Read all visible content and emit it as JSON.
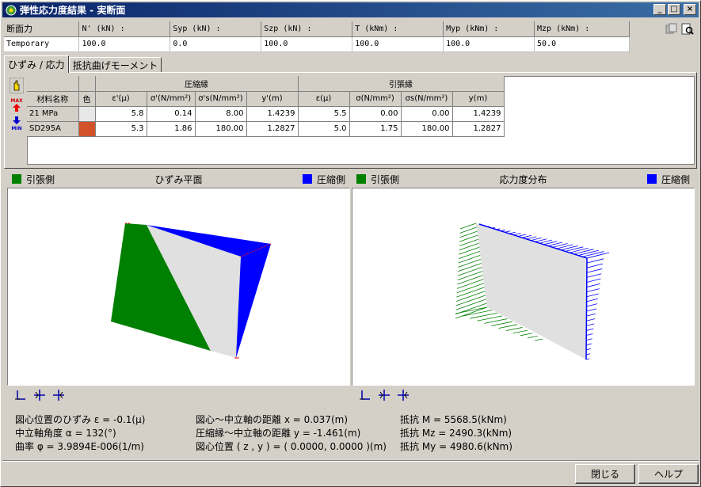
{
  "window": {
    "title": "弾性応力度結果 - 実断面"
  },
  "force": {
    "row_header": "断面力",
    "row_label": "Temporary",
    "columns": [
      {
        "label": "N' (kN) :",
        "value": "100.0"
      },
      {
        "label": "Syp (kN) :",
        "value": "0.0"
      },
      {
        "label": "Szp (kN) :",
        "value": "100.0"
      },
      {
        "label": "T (kNm) :",
        "value": "100.0"
      },
      {
        "label": "Myp (kNm) :",
        "value": "100.0"
      },
      {
        "label": "Mzp (kNm) :",
        "value": "50.0"
      }
    ]
  },
  "tabs": [
    {
      "label": "ひずみ / 応力"
    },
    {
      "label": "抵抗曲げモーメント"
    }
  ],
  "table": {
    "group_comp": "圧縮縁",
    "group_tens": "引張縁",
    "h_name": "材料名称",
    "h_color": "色",
    "headers": [
      "ε'(μ)",
      "σ'(N/mm²)",
      "σ's(N/mm²)",
      "y'(m)",
      "ε(μ)",
      "σ(N/mm²)",
      "σs(N/mm²)",
      "y(m)"
    ],
    "rows": [
      {
        "name": "21 MPa",
        "color": "#e8e8e8",
        "vals": [
          "5.8",
          "0.14",
          "8.00",
          "1.4239",
          "5.5",
          "0.00",
          "0.00",
          "1.4239"
        ]
      },
      {
        "name": "SD295A",
        "color": "#d2522a",
        "vals": [
          "5.3",
          "1.86",
          "180.00",
          "1.2827",
          "5.0",
          "1.75",
          "180.00",
          "1.2827"
        ]
      }
    ]
  },
  "side_icons": [
    "hand-icon",
    "max-icon",
    "min-icon"
  ],
  "left_chart": {
    "legend_left": "引張側",
    "title": "ひずみ平面",
    "legend_right": "圧縮側",
    "color_tension": "#008000",
    "color_compression": "#0000ff"
  },
  "right_chart": {
    "legend_left": "引張側",
    "title": "応力度分布",
    "legend_right": "圧縮側",
    "color_tension": "#008000",
    "color_compression": "#0000ff"
  },
  "info": {
    "col1": [
      "図心位置のひずみ ε = -0.1(μ)",
      "中立軸角度 α = 132(°)",
      "曲率 φ = 3.9894E-006(1/m)"
    ],
    "col2": [
      "図心～中立軸の距離 x = 0.037(m)",
      "圧縮縁～中立軸の距離 y = -1.461(m)",
      "図心位置 ( z , y ) = ( 0.0000, 0.0000 )(m)"
    ],
    "col3": [
      "抵抗 M = 5568.5(kNm)",
      "抵抗 Mz = 2490.3(kNm)",
      "抵抗 My = 4980.6(kNm)"
    ]
  },
  "buttons": {
    "close": "閉じる",
    "help": "ヘルプ"
  }
}
